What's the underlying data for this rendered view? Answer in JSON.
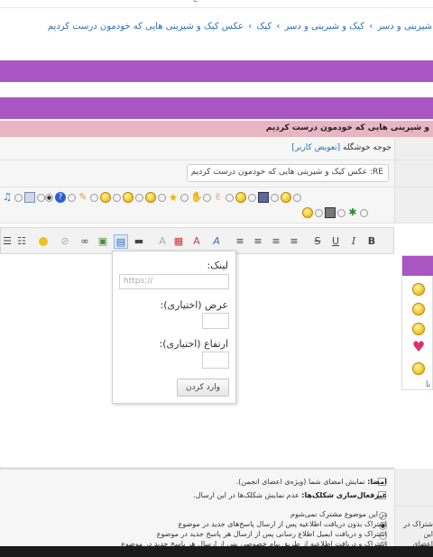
{
  "header": {
    "breadcrumb": [
      "شیرینی و دسر",
      "کیک و شیرینی و دسر",
      "کیک",
      "عکس کیک و شیرینی هایی که خودمون درست کردیم"
    ],
    "separator": "›"
  },
  "thread": {
    "title_row": "و شیرینی هایی که خودمون درست کردیم"
  },
  "form": {
    "user_prefix": "جوجه خوشگله",
    "change_user_link": "[تعویض کاربر]",
    "subject_value": "RE: عکس کیک و شیرینی هایی که خودمون درست کردیم"
  },
  "toolbar": {
    "bold": "B",
    "italic": "I",
    "underline": "U",
    "strike": "S"
  },
  "link_popup": {
    "link_label": "لینک:",
    "link_placeholder": "https://",
    "width_label": "عرض (اختیاری):",
    "height_label": "ارتفاع (اختیاری):",
    "insert_button": "وارد کردن"
  },
  "smilies": {
    "more_link": "نا"
  },
  "options": {
    "signature_bold": "امضا:",
    "signature_text": " نمایش امضای شما (ویژه‌ی اعضای انجمن).",
    "disable_smilies_bold": "غیرفعال‌سازی شکلک‌ها:",
    "disable_smilies_text": " عدم نمایش شکلک‌ها در این ارسال."
  },
  "subscription": {
    "option1": "در این موضوع مشترک نمی‌شوم",
    "option2": "اشتراک بدون دریافت اطلاعیه پس از ارسال پاسخ‌های جدید در موضوع",
    "option3": "اشتراک و دریافت ایمیل اطلاع رسانی پس از ارسال هر پاسخ جدید در موضوع",
    "option4": "اشتراک و دریافت اطلاعیه از طریق پیام خصوصی پس از ارسال هر پاسخ جدید در موضوع",
    "right_note_line1": "شتراک در این",
    "right_note_line2": "اعضای"
  }
}
